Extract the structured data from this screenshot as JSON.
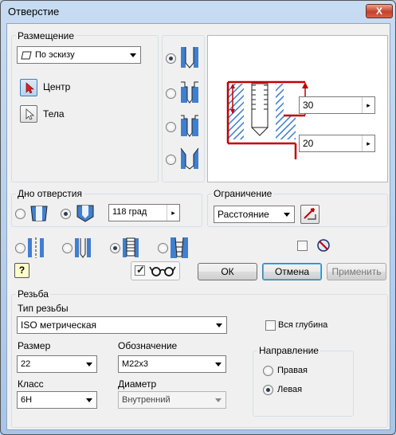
{
  "window": {
    "title": "Отверстие",
    "close": "X"
  },
  "placement": {
    "group": "Размещение",
    "combo": "По эскизу",
    "center": "Центр",
    "bodies": "Тела"
  },
  "preview": {
    "depth": "30",
    "diameter": "20"
  },
  "bottom": {
    "group": "Дно отверстия",
    "angle": "118 град"
  },
  "limit": {
    "group": "Ограничение",
    "combo": "Расстояние"
  },
  "buttons": {
    "ok": "ОК",
    "cancel": "Отмена",
    "apply": "Применить",
    "help": "?"
  },
  "thread": {
    "group": "Резьба",
    "type_label": "Тип резьбы",
    "type": "ISO метрическая",
    "full_depth": "Вся глубина",
    "size_label": "Размер",
    "size": "22",
    "designation_label": "Обозначение",
    "designation": "M22x3",
    "class_label": "Класс",
    "class": "6H",
    "diameter_label": "Диаметр",
    "diameter": "Внутренний",
    "direction": {
      "group": "Направление",
      "right": "Правая",
      "left": "Левая"
    }
  },
  "colors": {
    "hatch": "#3f7fd0",
    "dim": "#c00000"
  }
}
